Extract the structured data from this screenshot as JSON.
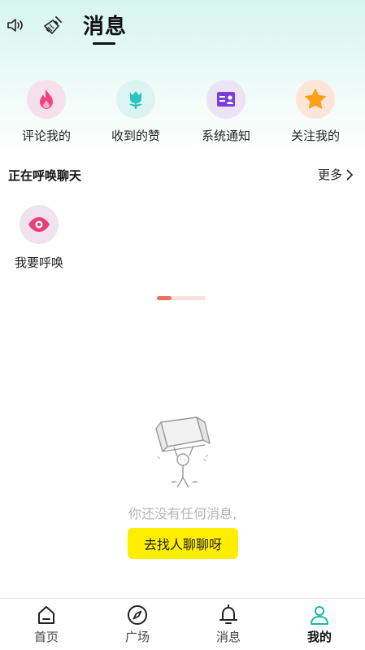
{
  "header": {
    "title": "消息",
    "icons": [
      "speaker-icon",
      "broom-icon"
    ]
  },
  "quick_actions": [
    {
      "label": "评论我的",
      "icon": "flame-icon",
      "bg": "#f6e0ee",
      "color": "#f0437d"
    },
    {
      "label": "收到的赞",
      "icon": "tulip-icon",
      "bg": "#dcf5f3",
      "color": "#2cc4c0"
    },
    {
      "label": "系统通知",
      "icon": "id-card-icon",
      "bg": "#ece3f7",
      "color": "#7b3fd8"
    },
    {
      "label": "关注我的",
      "icon": "star-icon",
      "bg": "#fde6d9",
      "color": "#ff9f1a"
    }
  ],
  "section": {
    "title": "正在呼唤聊天",
    "more": "更多"
  },
  "summon": {
    "label": "我要呼唤",
    "icon": "eye-icon",
    "color": "#e9407a"
  },
  "empty": {
    "message": "你还没有任何消息,",
    "cta": "去找人聊聊呀"
  },
  "tabbar": {
    "items": [
      {
        "label": "首页",
        "icon": "home-icon",
        "active": false
      },
      {
        "label": "广场",
        "icon": "compass-icon",
        "active": false
      },
      {
        "label": "消息",
        "icon": "bell-icon",
        "active": false
      },
      {
        "label": "我的",
        "icon": "profile-icon",
        "active": true
      }
    ]
  },
  "colors": {
    "accent": "#ffee00",
    "header_gradient": "#d7f5ef",
    "pager_active": "#e8735b",
    "active_tab_icon": "#1bb5a5"
  }
}
